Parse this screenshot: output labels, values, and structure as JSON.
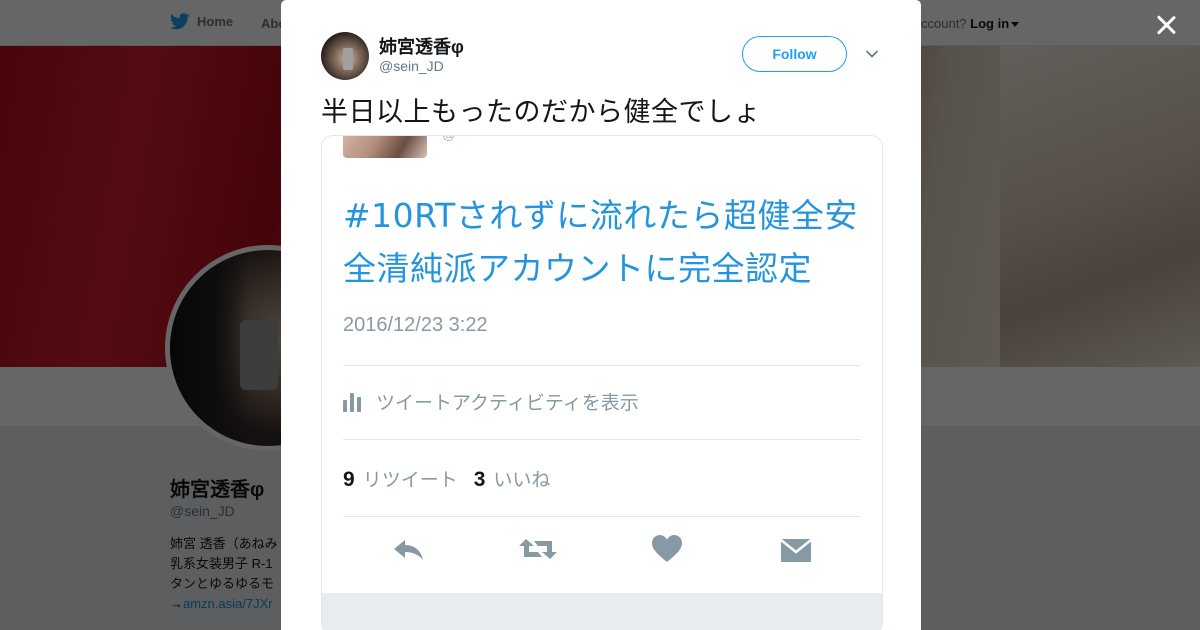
{
  "topbar": {
    "home_label": "Home",
    "about_label": "Abo",
    "account_prefix": "ccount?",
    "login_label": "Log in"
  },
  "profile": {
    "name": "姉宮透香φ",
    "handle": "@sein_JD",
    "bio_lines": [
      "姉宮 透香（あねみ",
      "乳系女装男子 R-1",
      "タンとゆるゆるモ"
    ],
    "bio_link_prefix": "→",
    "bio_link": "amzn.asia/7JXr"
  },
  "tweet": {
    "author_name": "姉宮透香φ",
    "author_handle": "@sein_JD",
    "follow_label": "Follow",
    "text": "半日以上もったのだから健全でしょ"
  },
  "media": {
    "handle_fragment": "@",
    "hashtag_line1": "#10RTされずに流れたら超健全安",
    "hashtag_line2": "全清純派アカウントに完全認定",
    "timestamp": "2016/12/23 3:22",
    "activity_label": "ツイートアクティビティを表示",
    "retweet_count": "9",
    "retweet_label": "リツイート",
    "like_count": "3",
    "like_label": "いいね"
  },
  "colors": {
    "twitter_blue": "#1da1f2",
    "hashtag_blue": "#2495dd",
    "text_dark": "#14171a",
    "text_gray": "#657786"
  },
  "icons": [
    "twitter-bird-icon",
    "close-icon",
    "chevron-down-icon",
    "activity-bars-icon",
    "reply-icon",
    "retweet-icon",
    "like-heart-icon",
    "direct-message-icon"
  ]
}
